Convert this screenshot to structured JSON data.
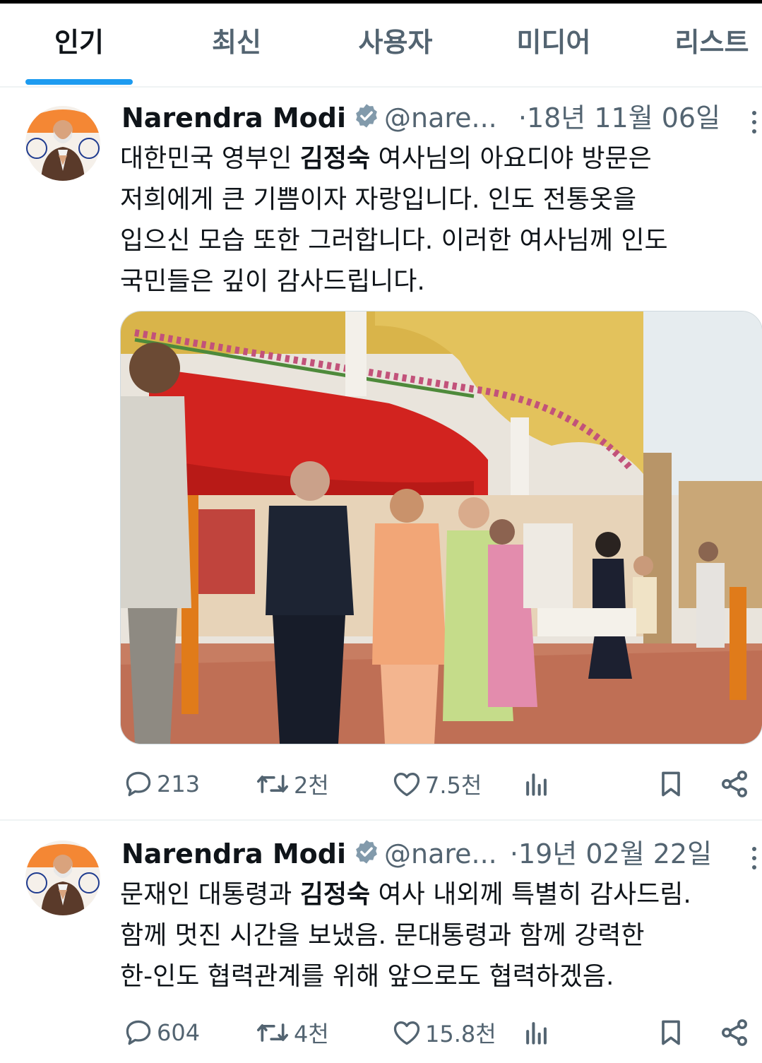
{
  "tabs": [
    {
      "label": "인기",
      "active": true
    },
    {
      "label": "최신",
      "active": false
    },
    {
      "label": "사용자",
      "active": false
    },
    {
      "label": "미디어",
      "active": false
    },
    {
      "label": "리스트",
      "active": false
    }
  ],
  "colors": {
    "accent": "#1d9bf0",
    "muted": "#536471",
    "text": "#0f1419"
  },
  "tweets": [
    {
      "name": "Narendra Modi",
      "handle": "@nare...",
      "dot": "·",
      "date": "18년 11월 06일",
      "text": {
        "l1_pre": "대한민국 영부인 ",
        "l1_bold": "김정숙",
        "l1_post": " 여사님의 아요디야 방문은",
        "l2": "저희에게 큰 기쁨이자 자랑입니다. 인도 전통옷을",
        "l3": "입으신 모습 또한 그러합니다. 이러한 여사님께 인도",
        "l4": "국민들은 깊이 감사드립니다."
      },
      "has_media": true,
      "replies": "213",
      "reposts": "2천",
      "likes": "7.5천"
    },
    {
      "name": "Narendra Modi",
      "handle": "@nare...",
      "dot": "·",
      "date": "19년 02월 22일",
      "text": {
        "l1_pre": "문재인 대통령과 ",
        "l1_bold": "김정숙",
        "l1_post": " 여사 내외께 특별히 감사드림.",
        "l2": "함께 멋진 시간을 보냈음. 문대통령과 함께 강력한",
        "l3": "한-인도 협력관계를 위해 앞으로도 협력하겠음."
      },
      "has_media": false,
      "replies": "604",
      "reposts": "4천",
      "likes": "15.8천"
    }
  ]
}
